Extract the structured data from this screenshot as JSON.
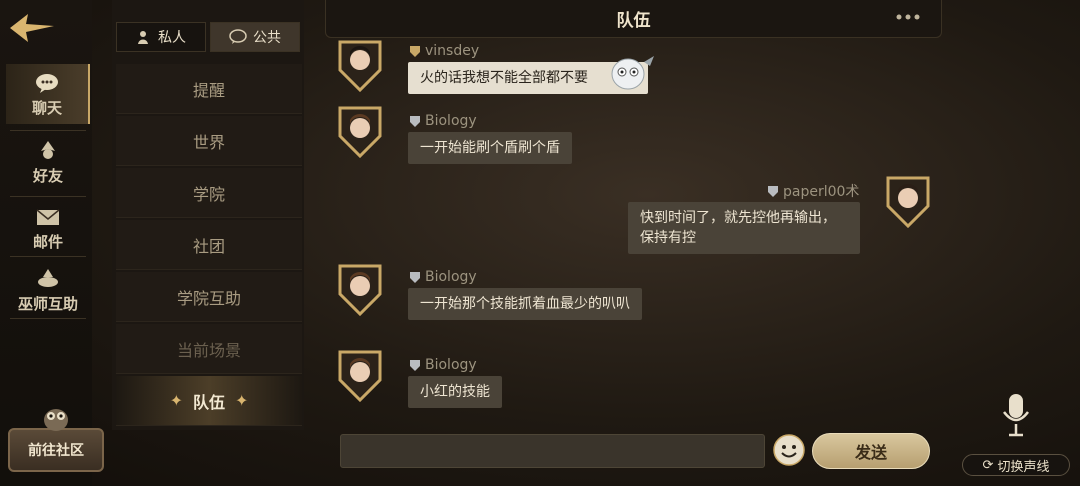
{
  "nav": {
    "items": [
      {
        "label": "聊天",
        "icon": "chat-bubble-icon",
        "active": true
      },
      {
        "label": "好友",
        "icon": "friend-icon"
      },
      {
        "label": "邮件",
        "icon": "mail-icon"
      },
      {
        "label": "巫师互助",
        "icon": "wizard-help-icon"
      }
    ],
    "community_label": "前往社区"
  },
  "channels": {
    "tabs": [
      {
        "label": "私人",
        "icon": "private-icon"
      },
      {
        "label": "公共",
        "icon": "public-icon",
        "selected": true
      }
    ],
    "items": [
      {
        "label": "提醒"
      },
      {
        "label": "世界"
      },
      {
        "label": "学院"
      },
      {
        "label": "社团"
      },
      {
        "label": "学院互助"
      },
      {
        "label": "当前场景",
        "disabled": true
      },
      {
        "label": "队伍",
        "active": true
      }
    ]
  },
  "header": {
    "title": "队伍"
  },
  "messages": [
    {
      "user": "vinsdey",
      "text": "火的话我想不能全部都不要",
      "side": "left",
      "style": "light"
    },
    {
      "user": "Biology",
      "text": "一开始能刷个盾刷个盾",
      "side": "left"
    },
    {
      "user": "paperl00术",
      "text": "快到时间了，就先控他再输出，保持有控",
      "side": "right"
    },
    {
      "user": "Biology",
      "text": "一开始那个技能抓着血最少的叭叭",
      "side": "left"
    },
    {
      "user": "Biology",
      "text": "小红的技能",
      "side": "left"
    }
  ],
  "composer": {
    "send_label": "发送",
    "voice_toggle_label": "切换声线"
  },
  "colors": {
    "gold": "#c9a867",
    "bubble": "#4a4338",
    "bubble_light": "#e6dfd0"
  }
}
